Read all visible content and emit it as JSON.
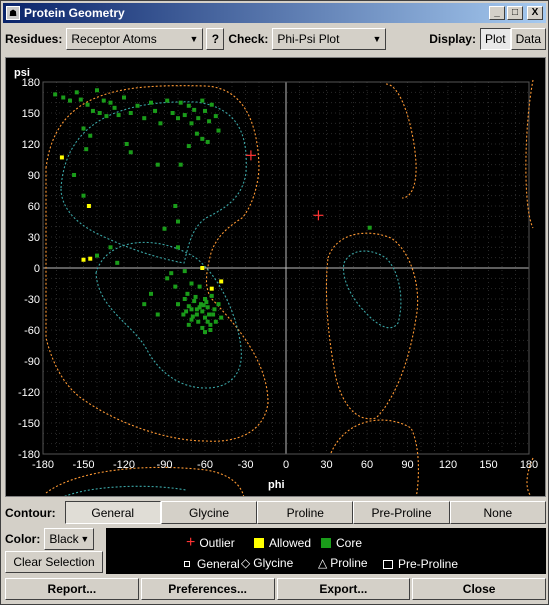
{
  "window": {
    "title": "Protein Geometry",
    "minimize": "_",
    "maximize": "□",
    "close": "X"
  },
  "toolbar": {
    "residues_label": "Residues:",
    "residues_value": "Receptor Atoms",
    "help_label": "?",
    "check_label": "Check:",
    "check_value": "Phi-Psi Plot",
    "display_label": "Display:",
    "plot_label": "Plot",
    "data_label": "Data"
  },
  "plot": {
    "psi_label": "psi",
    "phi_label": "phi",
    "x_ticks": [
      "-180",
      "-150",
      "-120",
      "-90",
      "-60",
      "-30",
      "0",
      "30",
      "60",
      "90",
      "120",
      "150",
      "180"
    ],
    "y_ticks": [
      "180",
      "150",
      "120",
      "90",
      "60",
      "30",
      "0",
      "-30",
      "-60",
      "-90",
      "-120",
      "-150",
      "-180"
    ],
    "colors": {
      "core": "#1a9c1a",
      "allowed": "#ffff00",
      "outlier": "#ff3333",
      "contour_general": "#ff9933",
      "contour_inner": "#3aa5a5"
    }
  },
  "chart_data": {
    "type": "scatter",
    "xlabel": "phi",
    "ylabel": "psi",
    "xlim": [
      -180,
      180
    ],
    "ylim": [
      -180,
      180
    ],
    "grid": true,
    "series": [
      {
        "name": "Core",
        "color": "#1a9c1a",
        "points": [
          [
            -171,
            168
          ],
          [
            -165,
            165
          ],
          [
            -160,
            162
          ],
          [
            -155,
            170
          ],
          [
            -152,
            163
          ],
          [
            -147,
            158
          ],
          [
            -143,
            152
          ],
          [
            -140,
            172
          ],
          [
            -138,
            150
          ],
          [
            -135,
            162
          ],
          [
            -133,
            147
          ],
          [
            -130,
            160
          ],
          [
            -127,
            155
          ],
          [
            -124,
            148
          ],
          [
            -120,
            165
          ],
          [
            -115,
            150
          ],
          [
            -110,
            157
          ],
          [
            -105,
            145
          ],
          [
            -100,
            160
          ],
          [
            -97,
            152
          ],
          [
            -93,
            140
          ],
          [
            -88,
            162
          ],
          [
            -84,
            150
          ],
          [
            -80,
            145
          ],
          [
            -78,
            160
          ],
          [
            -75,
            148
          ],
          [
            -72,
            157
          ],
          [
            -70,
            140
          ],
          [
            -68,
            153
          ],
          [
            -65,
            145
          ],
          [
            -62,
            162
          ],
          [
            -60,
            152
          ],
          [
            -57,
            142
          ],
          [
            -55,
            158
          ],
          [
            -52,
            147
          ],
          [
            -50,
            133
          ],
          [
            -62,
            125
          ],
          [
            -72,
            118
          ],
          [
            -66,
            130
          ],
          [
            -58,
            122
          ],
          [
            -150,
            135
          ],
          [
            -145,
            128
          ],
          [
            -148,
            115
          ],
          [
            -118,
            120
          ],
          [
            -115,
            112
          ],
          [
            -95,
            100
          ],
          [
            -78,
            100
          ],
          [
            -157,
            90
          ],
          [
            -150,
            70
          ],
          [
            -82,
            60
          ],
          [
            -80,
            45
          ],
          [
            -90,
            38
          ],
          [
            -130,
            20
          ],
          [
            -140,
            12
          ],
          [
            -125,
            5
          ],
          [
            -80,
            20
          ],
          [
            -85,
            -5
          ],
          [
            -75,
            -3
          ],
          [
            -70,
            -15
          ],
          [
            -64,
            -18
          ],
          [
            -88,
            -10
          ],
          [
            -82,
            -18
          ],
          [
            -73,
            -25
          ],
          [
            -67,
            -28
          ],
          [
            -60,
            -30
          ],
          [
            -55,
            -27
          ],
          [
            -50,
            -35
          ],
          [
            -72,
            -37
          ],
          [
            -66,
            -40
          ],
          [
            -62,
            -42
          ],
          [
            -58,
            -38
          ],
          [
            -54,
            -45
          ],
          [
            -48,
            -48
          ],
          [
            -76,
            -45
          ],
          [
            -70,
            -50
          ],
          [
            -65,
            -52
          ],
          [
            -60,
            -48
          ],
          [
            -56,
            -55
          ],
          [
            -52,
            -52
          ],
          [
            -68,
            -32
          ],
          [
            -63,
            -35
          ],
          [
            -75,
            -30
          ],
          [
            -57,
            -45
          ],
          [
            -62,
            -58
          ],
          [
            -70,
            -40
          ],
          [
            -80,
            -35
          ],
          [
            -66,
            -45
          ],
          [
            -59,
            -33
          ],
          [
            -53,
            -40
          ],
          [
            -61,
            -36
          ],
          [
            -74,
            -42
          ],
          [
            -69,
            -47
          ],
          [
            -58,
            -52
          ],
          [
            -64,
            -38
          ],
          [
            -56,
            -60
          ],
          [
            -72,
            -55
          ],
          [
            -60,
            -62
          ],
          [
            -95,
            -45
          ],
          [
            -100,
            -25
          ],
          [
            -105,
            -35
          ],
          [
            62,
            39
          ]
        ]
      },
      {
        "name": "Allowed",
        "color": "#ffff00",
        "points": [
          [
            -166,
            107
          ],
          [
            -146,
            60
          ],
          [
            -150,
            8
          ],
          [
            -145,
            9
          ],
          [
            -62,
            0
          ],
          [
            -48,
            -13
          ],
          [
            -55,
            -20
          ]
        ]
      },
      {
        "name": "Outlier",
        "color": "#ff3333",
        "points": [
          [
            -26,
            109
          ],
          [
            24,
            51
          ]
        ]
      }
    ]
  },
  "contour": {
    "label": "Contour:",
    "options": [
      "General",
      "Glycine",
      "Proline",
      "Pre-Proline",
      "None"
    ],
    "selected_index": 0
  },
  "lower": {
    "color_label": "Color:",
    "color_value": "Black",
    "clear_label": "Clear Selection"
  },
  "legend": {
    "outlier": "Outlier",
    "allowed": "Allowed",
    "core": "Core",
    "general": "General",
    "glycine": "Glycine",
    "proline": "Proline",
    "preproline": "Pre-Proline"
  },
  "bottom": {
    "report": "Report...",
    "preferences": "Preferences...",
    "export": "Export...",
    "close": "Close"
  }
}
